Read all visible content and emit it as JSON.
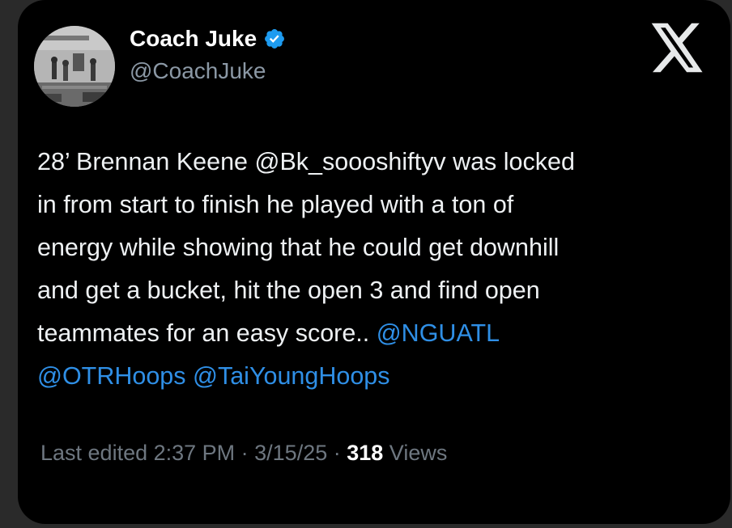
{
  "author": {
    "name": "Coach Juke",
    "handle": "@CoachJuke",
    "verified": true,
    "avatar": "basketball-court-photo"
  },
  "platform_icon": "x-logo-icon",
  "tweet": {
    "line1": "28’ Brennan Keene @Bk_soooshiftyv was locked",
    "line2": "in from start to finish he played with a ton of",
    "line3": "energy while showing that he could get downhill",
    "line4": "and get a bucket, hit the open 3 and find open",
    "line5_text": "teammates for an easy score.. ",
    "mention_nguatl": "@NGUATL",
    "mention_otrhoops": "@OTRHoops",
    "mention_taiyounghoops": "@TaiYoungHoops"
  },
  "meta": {
    "edited_label": "Last edited 2:37 PM · 3/15/25 · ",
    "views_count": "318",
    "views_label": " Views"
  },
  "colors": {
    "background": "#000000",
    "text": "#eef1f3",
    "secondary": "#8b98a5",
    "mention": "#2f8fe6",
    "verified_badge": "#1d9bf0"
  }
}
